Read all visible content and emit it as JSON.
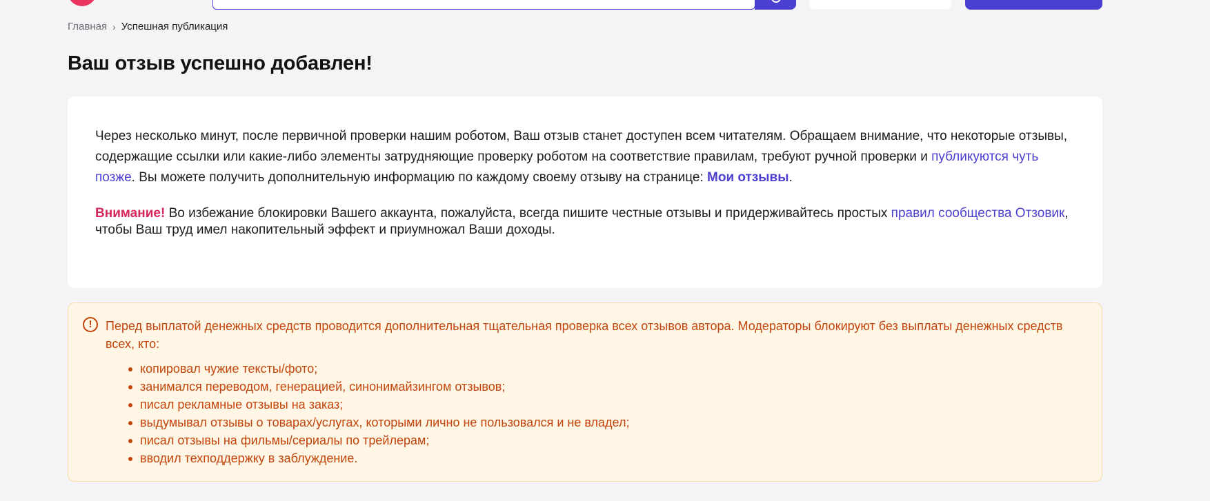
{
  "breadcrumb": {
    "home": "Главная",
    "separator": "›",
    "current": "Успешная публикация"
  },
  "page_title": "Ваш отзыв успешно добавлен!",
  "card": {
    "p1_text_a": "Через несколько минут, после первичной проверки нашим роботом, Ваш отзыв станет доступен всем читателям. Обращаем внимание, что некоторые отзывы, содержащие ссылки или какие-либо элементы затрудняющие проверку роботом на соответствие правилам, требуют ручной проверки и ",
    "p1_link": "публикуются чуть позже",
    "p1_text_b": ". Вы можете получить дополнительную информацию по каждому своему отзыву на странице: ",
    "my_reviews_link": "Мои отзывы",
    "p1_end": ".",
    "notice_label": "Внимание!",
    "notice_text_a": " Во избежание блокировки Вашего аккаунта, пожалуйста, всегда пишите честные отзывы и придерживайтесь простых ",
    "rules_link": "правил сообщества Отзовик",
    "notice_text_b": ", чтобы Ваш труд имел накопительный эффект и приумножал Ваши доходы."
  },
  "alert": {
    "icon_glyph": "!",
    "lead": "Перед выплатой денежных средств проводится дополнительная тщательная проверка всех отзывов автора. Модераторы блокируют без выплаты денежных средств всех, кто:",
    "items": [
      "копировал чужие тексты/фото;",
      "занимался переводом, генерацией, синонимайзингом отзывов;",
      "писал рекламные отзывы на заказ;",
      "выдумывал отзывы о товарах/услугах, которыми лично не пользовался и не владел;",
      "писал отзывы на фильмы/сериалы по трейлерам;",
      "вводил техподдержку в заблуждение."
    ]
  },
  "colors": {
    "accent": "#4a3fd0",
    "brand": "#e8345f",
    "warning_text": "#c2450c",
    "warning_bg": "#fff6e5",
    "attention": "#d6265a"
  }
}
